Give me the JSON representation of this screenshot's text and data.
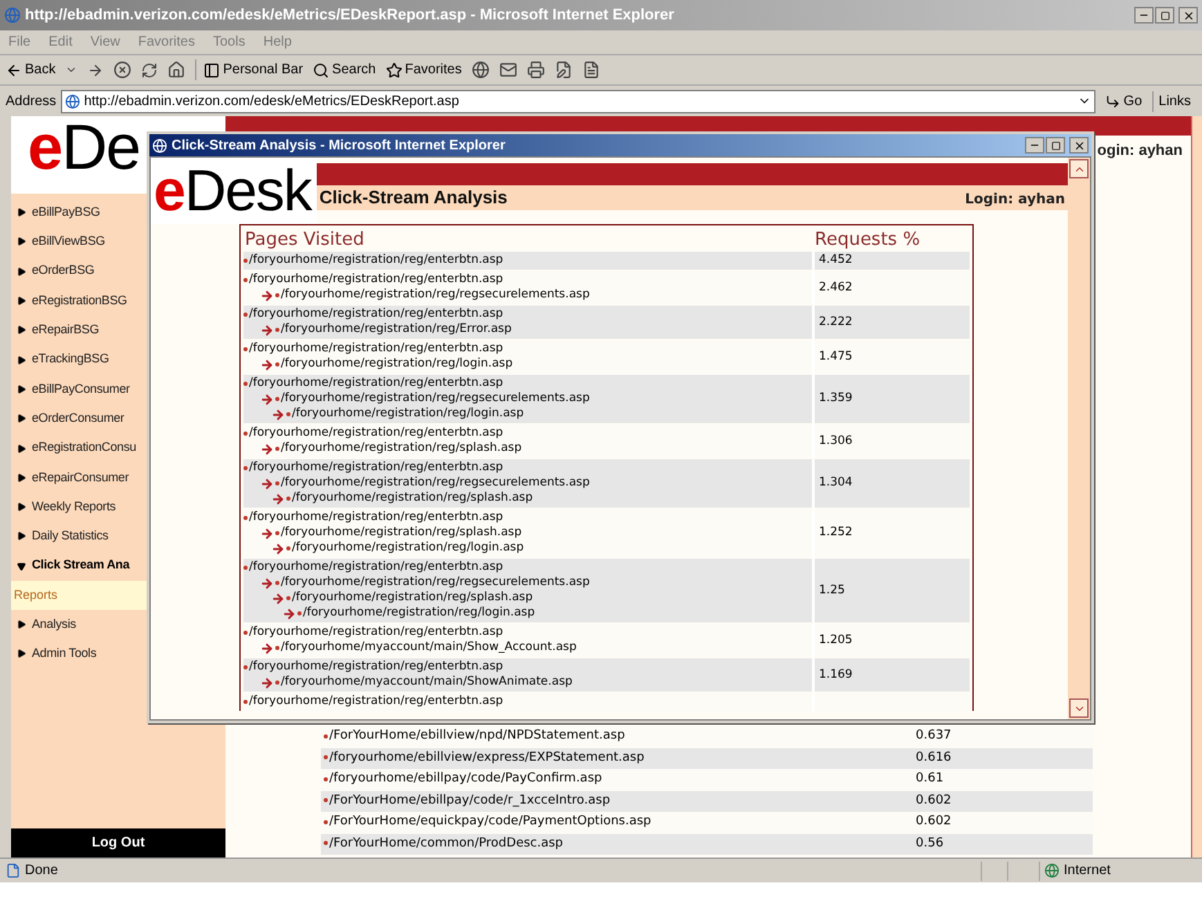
{
  "browser": {
    "title": "http://ebadmin.verizon.com/edesk/eMetrics/EDeskReport.asp - Microsoft Internet Explorer",
    "menu": [
      "File",
      "Edit",
      "View",
      "Favorites",
      "Tools",
      "Help"
    ],
    "toolbar": {
      "back": "Back",
      "personal_bar": "Personal Bar",
      "search": "Search",
      "favorites": "Favorites"
    },
    "address": {
      "label": "Address",
      "value": "http://ebadmin.verizon.com/edesk/eMetrics/EDeskReport.asp",
      "go": "Go",
      "links": "Links"
    }
  },
  "sidebar": {
    "logo": {
      "accent": "e",
      "rest": "De"
    },
    "items": [
      {
        "label": "eBillPayBSG",
        "expanded": false
      },
      {
        "label": "eBillViewBSG",
        "expanded": false
      },
      {
        "label": "eOrderBSG",
        "expanded": false
      },
      {
        "label": "eRegistrationBSG",
        "expanded": false
      },
      {
        "label": "eRepairBSG",
        "expanded": false
      },
      {
        "label": "eTrackingBSG",
        "expanded": false
      },
      {
        "label": "eBillPayConsumer",
        "expanded": false
      },
      {
        "label": "eOrderConsumer",
        "expanded": false
      },
      {
        "label": "eRegistrationConsu",
        "expanded": false
      },
      {
        "label": "eRepairConsumer",
        "expanded": false
      },
      {
        "label": "Weekly Reports",
        "expanded": false
      },
      {
        "label": "Daily Statistics",
        "expanded": false
      },
      {
        "label": "Click Stream Ana",
        "expanded": true,
        "children": [
          {
            "label": "Reports",
            "selected": true
          }
        ]
      },
      {
        "label": "Analysis",
        "expanded": false
      },
      {
        "label": "Admin Tools",
        "expanded": false
      }
    ],
    "logout": "Log Out"
  },
  "page": {
    "login": "ogin: ayhan",
    "rows": [
      {
        "path": "/ForYourHome/ebillview/npd/NPDStatement.asp",
        "value": "0.637"
      },
      {
        "path": "/foryourhome/ebillview/express/EXPStatement.asp",
        "value": "0.616"
      },
      {
        "path": "/foryourhome/ebillpay/code/PayConfirm.asp",
        "value": "0.61"
      },
      {
        "path": "/ForYourHome/ebillpay/code/r_1xcceIntro.asp",
        "value": "0.602"
      },
      {
        "path": "/ForYourHome/equickpay/code/PaymentOptions.asp",
        "value": "0.602"
      },
      {
        "path": "/ForYourHome/common/ProdDesc.asp",
        "value": "0.56"
      }
    ]
  },
  "popup": {
    "title": "Click-Stream Analysis - Microsoft Internet Explorer",
    "logo": {
      "accent": "e",
      "rest": "Desk"
    },
    "heading": "Click-Stream Analysis",
    "login": "Login: ayhan",
    "columns": [
      "Pages Visited",
      "Requests %"
    ],
    "rows": [
      {
        "path": [
          "/foryourhome/registration/reg/enterbtn.asp"
        ],
        "value": "4.452"
      },
      {
        "path": [
          "/foryourhome/registration/reg/enterbtn.asp",
          "/foryourhome/registration/reg/regsecurelements.asp"
        ],
        "value": "2.462"
      },
      {
        "path": [
          "/foryourhome/registration/reg/enterbtn.asp",
          "/foryourhome/registration/reg/Error.asp"
        ],
        "value": "2.222"
      },
      {
        "path": [
          "/foryourhome/registration/reg/enterbtn.asp",
          "/foryourhome/registration/reg/login.asp"
        ],
        "value": "1.475"
      },
      {
        "path": [
          "/foryourhome/registration/reg/enterbtn.asp",
          "/foryourhome/registration/reg/regsecurelements.asp",
          "/foryourhome/registration/reg/login.asp"
        ],
        "value": "1.359"
      },
      {
        "path": [
          "/foryourhome/registration/reg/enterbtn.asp",
          "/foryourhome/registration/reg/splash.asp"
        ],
        "value": "1.306"
      },
      {
        "path": [
          "/foryourhome/registration/reg/enterbtn.asp",
          "/foryourhome/registration/reg/regsecurelements.asp",
          "/foryourhome/registration/reg/splash.asp"
        ],
        "value": "1.304"
      },
      {
        "path": [
          "/foryourhome/registration/reg/enterbtn.asp",
          "/foryourhome/registration/reg/splash.asp",
          "/foryourhome/registration/reg/login.asp"
        ],
        "value": "1.252"
      },
      {
        "path": [
          "/foryourhome/registration/reg/enterbtn.asp",
          "/foryourhome/registration/reg/regsecurelements.asp",
          "/foryourhome/registration/reg/splash.asp",
          "/foryourhome/registration/reg/login.asp"
        ],
        "value": "1.25"
      },
      {
        "path": [
          "/foryourhome/registration/reg/enterbtn.asp",
          "/foryourhome/myaccount/main/Show_Account.asp"
        ],
        "value": "1.205"
      },
      {
        "path": [
          "/foryourhome/registration/reg/enterbtn.asp",
          "/foryourhome/myaccount/main/ShowAnimate.asp"
        ],
        "value": "1.169"
      },
      {
        "path": [
          "/foryourhome/registration/reg/enterbtn.asp"
        ]
      }
    ]
  },
  "status_bar": {
    "text": "Done",
    "zone": "Internet"
  }
}
